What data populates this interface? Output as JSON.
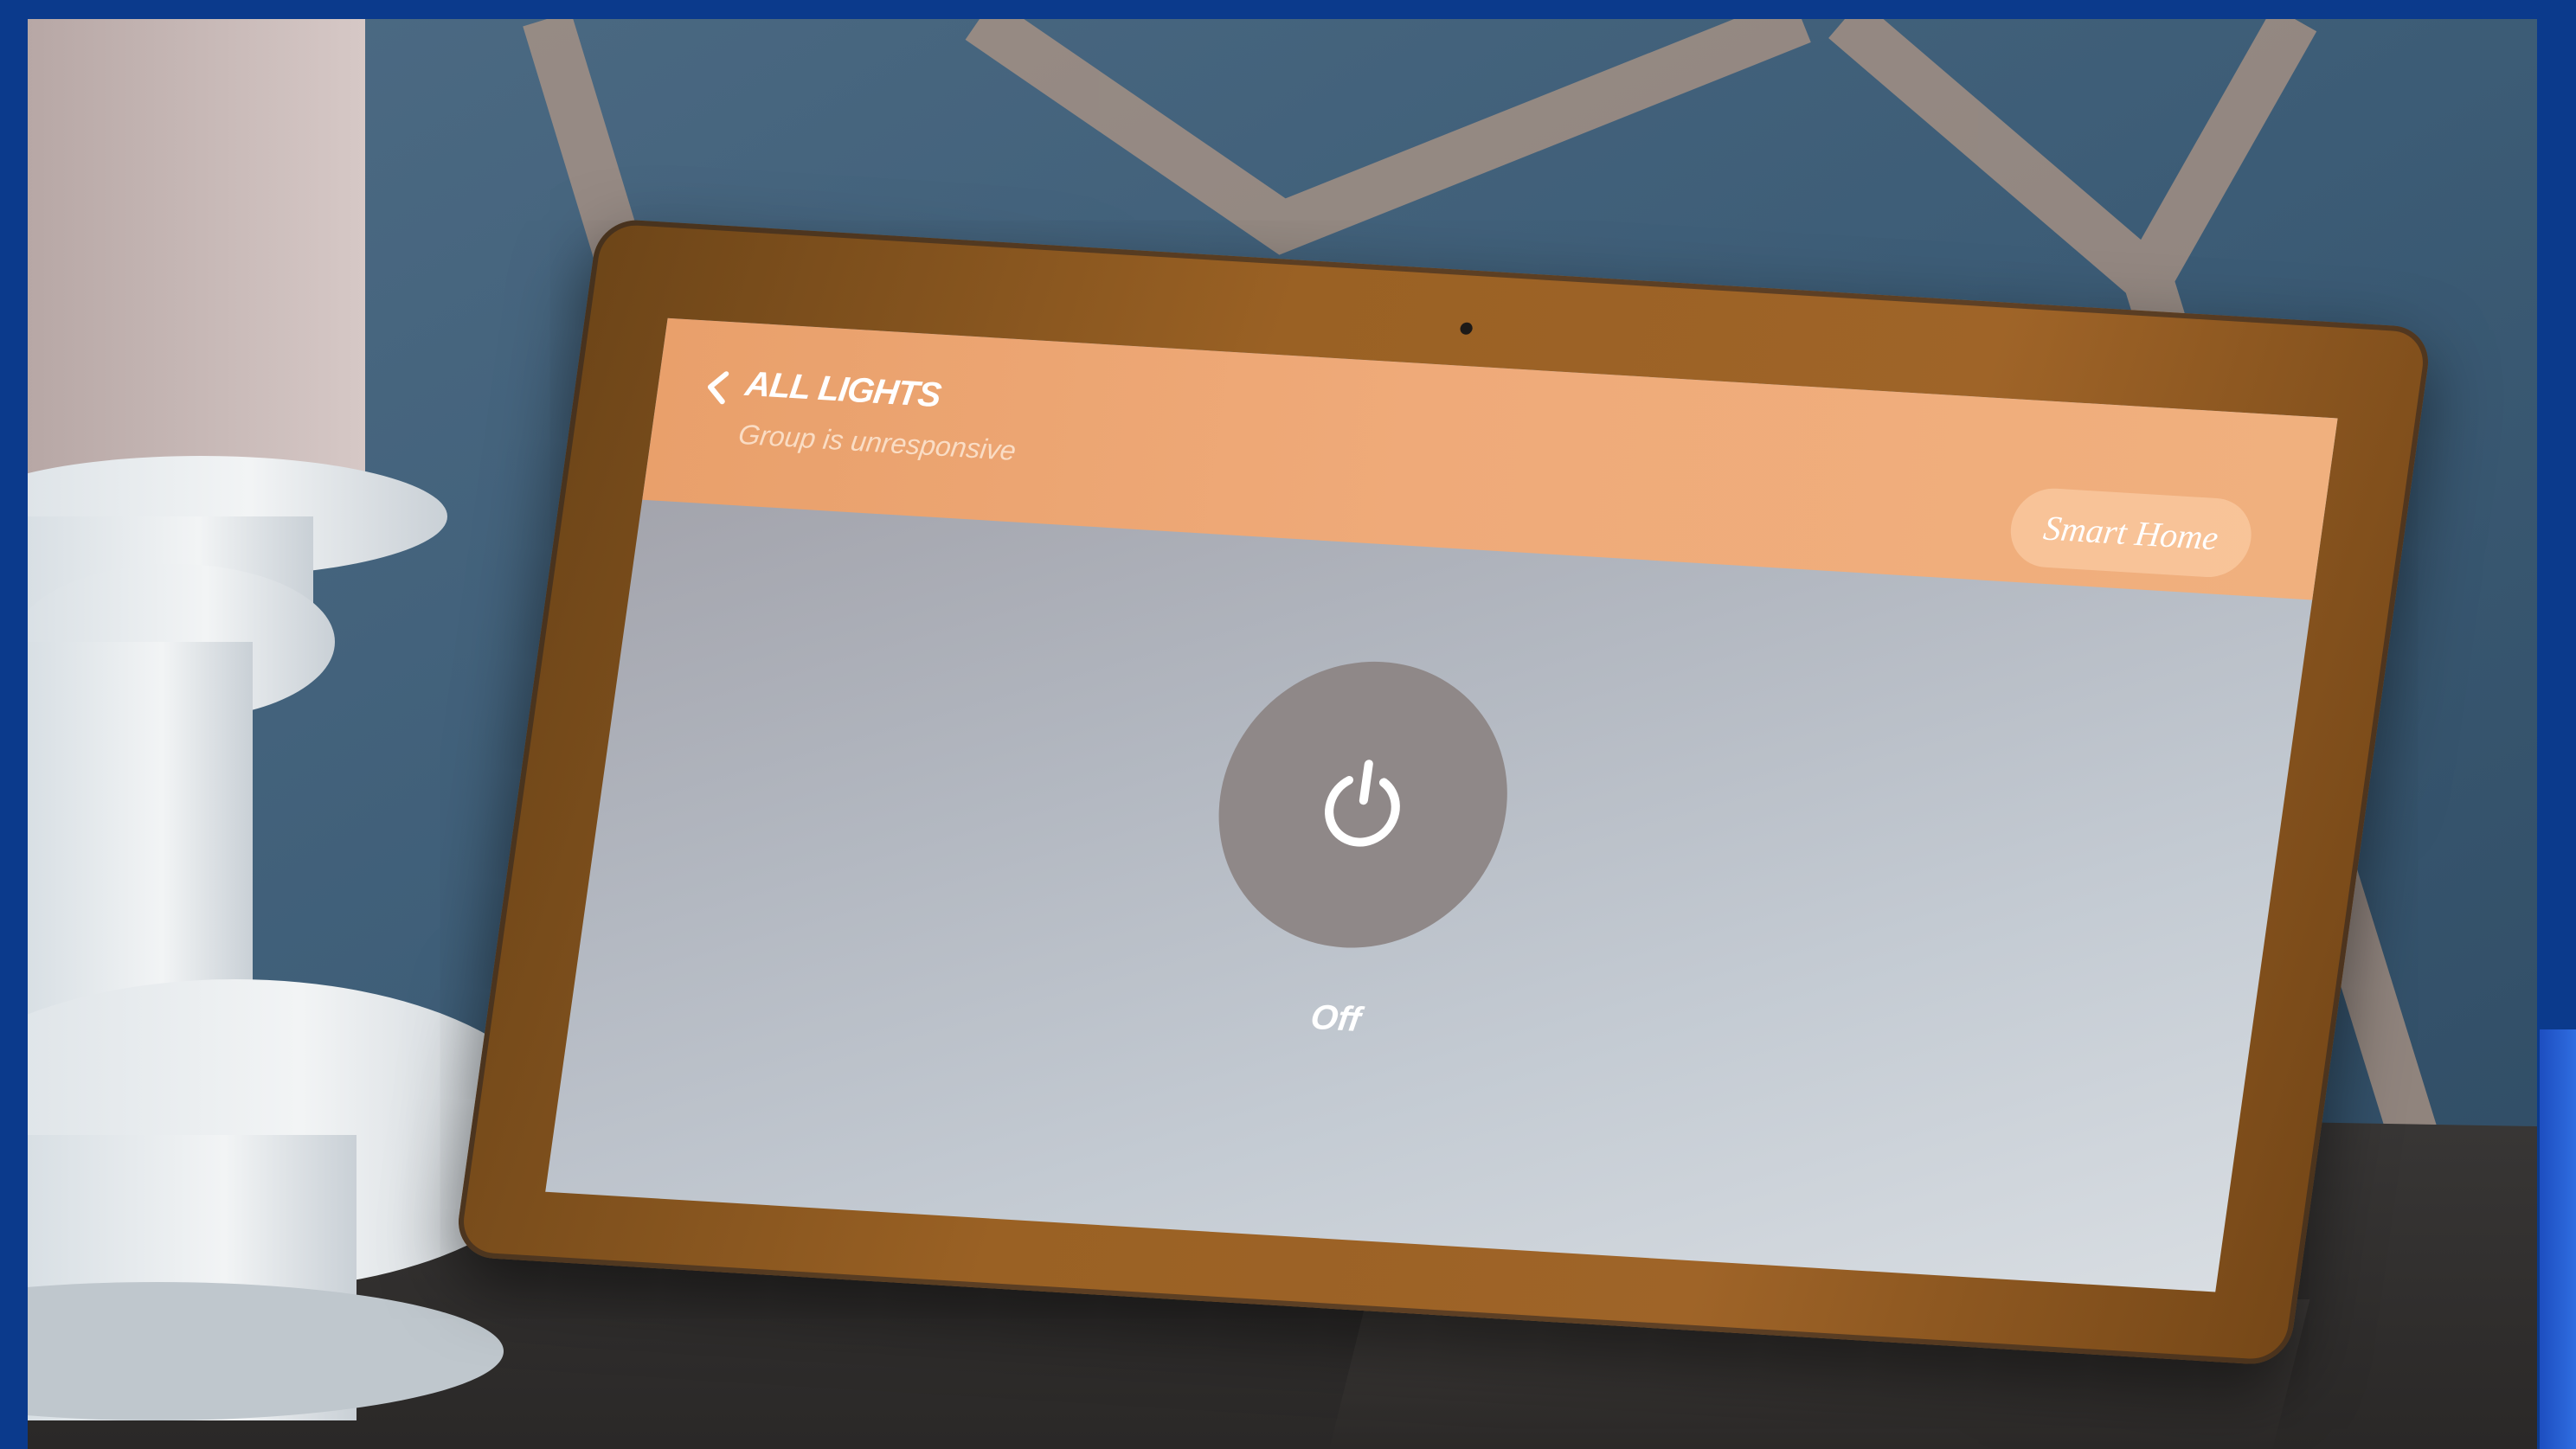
{
  "screen": {
    "header": {
      "back_icon": "chevron-left-icon",
      "title": "ALL LIGHTS",
      "status": "Group is unresponsive",
      "smart_home_label": "Smart Home"
    },
    "power": {
      "icon": "power-icon",
      "state_label": "Off"
    }
  },
  "colors": {
    "header": "#efaa79",
    "bezel": "#9a6124",
    "frame_border": "#0b3a8c",
    "power_button": "#8f8888"
  }
}
